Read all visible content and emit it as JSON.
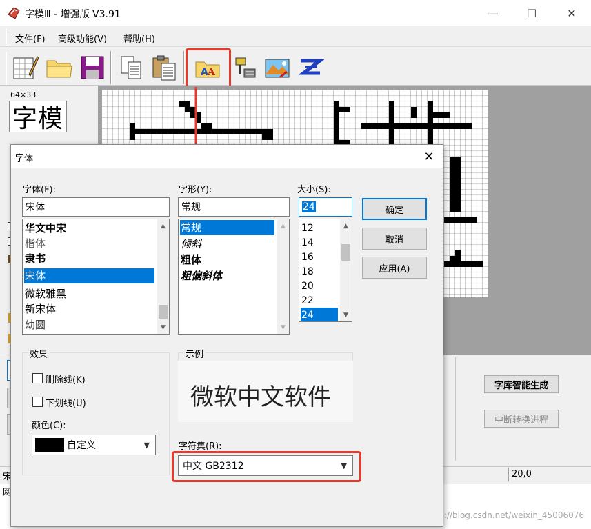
{
  "window": {
    "title": "字模Ⅲ - 增强版 V3.91",
    "minimize": "—",
    "maximize": "☐",
    "close": "✕"
  },
  "menu": [
    {
      "label": "文件(F)"
    },
    {
      "label": "高级功能(V)"
    },
    {
      "label": "帮助(H)"
    }
  ],
  "toolbar": {
    "icons": [
      "new-icon",
      "open-folder-icon",
      "save-icon",
      "copy-icon",
      "paste-icon",
      "font-icon",
      "settings-icon",
      "image-icon",
      "zoom-icon"
    ]
  },
  "left_panel": {
    "size_label": "64×33",
    "preview_text": "字模"
  },
  "right_panel": {
    "generate_button": "字库智能生成",
    "interrupt_button": "中断转换进程"
  },
  "status_bar": {
    "left_text": "宋",
    "right_value": "20,0",
    "bottom_left": "网"
  },
  "watermark": "https://blog.csdn.net/weixin_45006076",
  "font_dialog": {
    "title": "字体",
    "close": "✕",
    "font_label": "字体(F):",
    "font_value": "宋体",
    "font_list": [
      "华文中宋",
      "楷体",
      "隶书",
      "宋体",
      "微软雅黑",
      "新宋体",
      "幼圆"
    ],
    "font_selected_index": 3,
    "style_label": "字形(Y):",
    "style_value": "常规",
    "style_list": [
      "常规",
      "倾斜",
      "粗体",
      "粗偏斜体"
    ],
    "style_selected_index": 0,
    "size_label": "大小(S):",
    "size_value": "24",
    "size_list": [
      "12",
      "14",
      "16",
      "18",
      "20",
      "22",
      "24"
    ],
    "size_selected_index": 6,
    "ok_button": "确定",
    "cancel_button": "取消",
    "apply_button": "应用(A)",
    "effects_title": "效果",
    "strikeout_label": "删除线(K)",
    "underline_label": "下划线(U)",
    "color_label": "颜色(C):",
    "color_value": "自定义",
    "color_swatch": "#000000",
    "sample_title": "示例",
    "sample_text": "微软中文软件",
    "charset_label": "字符集(R):",
    "charset_value": "中文 GB2312"
  },
  "colors": {
    "accent": "#0078d7",
    "highlight": "#e53a2e"
  }
}
